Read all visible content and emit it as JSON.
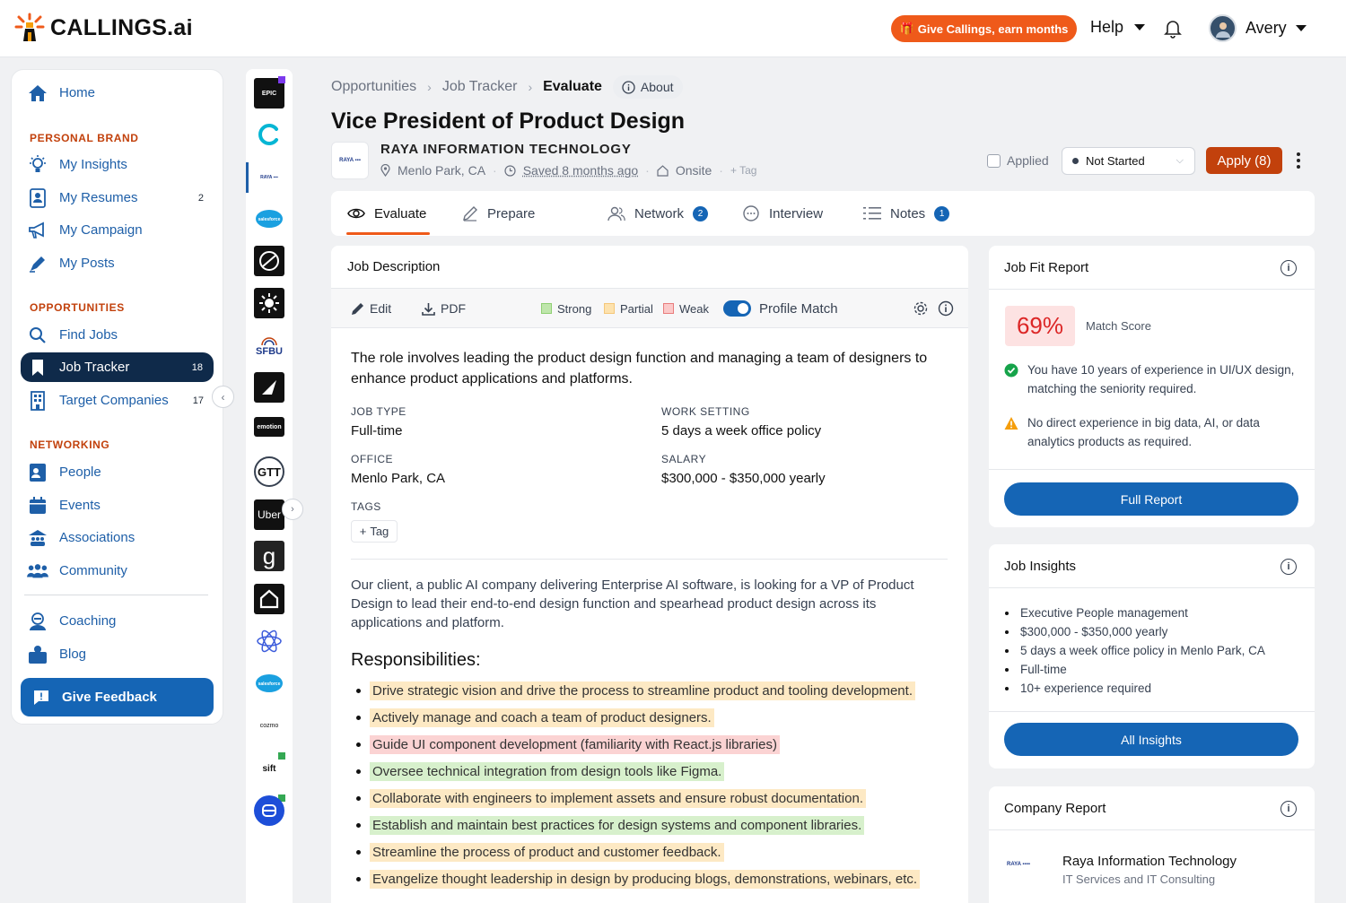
{
  "brand": {
    "name": "CALLINGS",
    "suffix": ".ai"
  },
  "header": {
    "promo_label": "Give Callings, earn months",
    "help_label": "Help",
    "user_name": "Avery"
  },
  "sidebar": {
    "home": "Home",
    "section_personal": "PERSONAL BRAND",
    "my_insights": "My Insights",
    "my_resumes": "My Resumes",
    "my_resumes_count": "2",
    "my_campaign": "My Campaign",
    "my_posts": "My Posts",
    "section_opportunities": "OPPORTUNITIES",
    "find_jobs": "Find Jobs",
    "job_tracker": "Job Tracker",
    "job_tracker_count": "18",
    "target_companies": "Target Companies",
    "target_companies_count": "17",
    "section_networking": "NETWORKING",
    "people": "People",
    "events": "Events",
    "associations": "Associations",
    "community": "Community",
    "coaching": "Coaching",
    "blog": "Blog",
    "feedback": "Give Feedback"
  },
  "rail": {
    "epic": "EPIC",
    "sfbu": "SFBU",
    "emotion": "emotion",
    "gtt": "GTT",
    "uber": "Uber",
    "g": "g",
    "cozmo": "cozmo",
    "sift": "sift",
    "salesforce": "salesforce"
  },
  "breadcrumb": {
    "opportunities": "Opportunities",
    "job_tracker": "Job Tracker",
    "current": "Evaluate",
    "about": "About"
  },
  "job": {
    "title": "Vice President of Product Design",
    "company": "RAYA INFORMATION TECHNOLOGY",
    "location": "Menlo Park, CA",
    "saved": "Saved 8 months ago",
    "setting": "Onsite",
    "tag": "Tag",
    "applied_label": "Applied",
    "status": "Not Started",
    "apply_label": "Apply (8)"
  },
  "tabs": {
    "evaluate": "Evaluate",
    "prepare": "Prepare",
    "network": "Network",
    "network_count": "2",
    "interview": "Interview",
    "notes": "Notes",
    "notes_count": "1"
  },
  "jd": {
    "header": "Job Description",
    "edit": "Edit",
    "pdf": "PDF",
    "strong": "Strong",
    "partial": "Partial",
    "weak": "Weak",
    "profile_match": "Profile Match",
    "summary": "The role involves leading the product design function and managing a team of designers to enhance product applications and platforms.",
    "job_type_label": "JOB TYPE",
    "job_type": "Full-time",
    "work_setting_label": "WORK SETTING",
    "work_setting": "5 days a week office policy",
    "office_label": "OFFICE",
    "office": "Menlo Park, CA",
    "salary_label": "SALARY",
    "salary": "$300,000 - $350,000 yearly",
    "tags_label": "TAGS",
    "tag_chip": "Tag",
    "paragraph": "Our client, a public AI company delivering Enterprise AI software, is looking for a VP of Product Design to lead their end-to-end design function and spearhead product design across its applications and platform.",
    "responsibilities_title": "Responsibilities:",
    "responsibilities": [
      {
        "text": "Drive strategic vision and drive the process to streamline product and tooling development.",
        "match": "partial"
      },
      {
        "text": "Actively manage and coach a team of product designers.",
        "match": "partial"
      },
      {
        "text": "Guide UI component development (familiarity with React.js libraries)",
        "match": "weak"
      },
      {
        "text": "Oversee technical integration from design tools like Figma.",
        "match": "strong"
      },
      {
        "text": "Collaborate with engineers to implement assets and ensure robust documentation.",
        "match": "partial"
      },
      {
        "text": "Establish and maintain best practices for design systems and component libraries.",
        "match": "strong"
      },
      {
        "text": "Streamline the process of product and customer feedback.",
        "match": "partial"
      },
      {
        "text": "Evangelize thought leadership in design by producing blogs, demonstrations, webinars, etc.",
        "match": "partial"
      }
    ]
  },
  "fit": {
    "header": "Job Fit Report",
    "score": "69%",
    "score_label": "Match Score",
    "positive": "You have 10 years of experience in UI/UX design, matching the seniority required.",
    "warning": "No direct experience in big data, AI, or data analytics products as required.",
    "button": "Full Report"
  },
  "insights": {
    "header": "Job Insights",
    "items": [
      "Executive People management",
      "$300,000 - $350,000 yearly",
      "5 days a week office policy in Menlo Park, CA",
      "Full-time",
      "10+ experience required"
    ],
    "button": "All Insights"
  },
  "company_report": {
    "header": "Company Report",
    "name": "Raya Information Technology",
    "industry": "IT Services and IT Consulting"
  },
  "colors": {
    "primary": "#1565b5",
    "accent": "#ef5a1a",
    "navy": "#0f2a4a",
    "strong": "#d7f0cc",
    "partial": "#fde9c4",
    "weak": "#fbd3d3"
  }
}
